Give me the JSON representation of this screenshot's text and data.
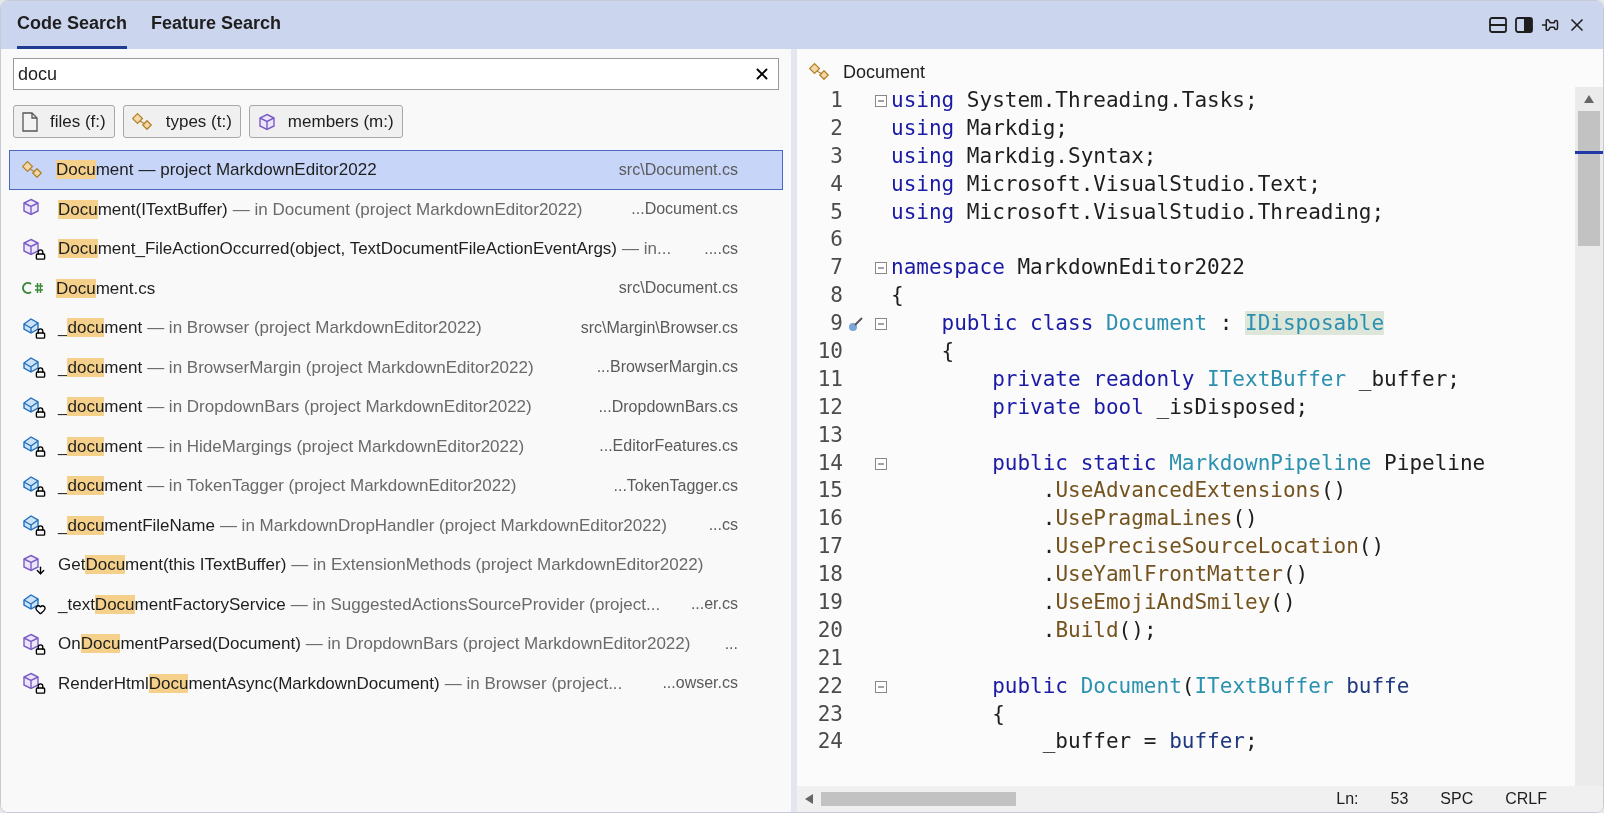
{
  "tabs": [
    {
      "label": "Code Search",
      "selected": true
    },
    {
      "label": "Feature Search",
      "selected": false
    }
  ],
  "search": {
    "value": "docu"
  },
  "filters": [
    {
      "kind": "file",
      "label": "files (f:)"
    },
    {
      "kind": "type",
      "label": "types (t:)"
    },
    {
      "kind": "member",
      "label": "members (m:)"
    }
  ],
  "results": [
    {
      "kind": "class",
      "match": "Docu",
      "after": "ment",
      "detail": "— project MarkdownEditor2022",
      "path": "src\\Document.cs",
      "selected": true
    },
    {
      "kind": "method",
      "match": "Docu",
      "after": "ment(ITextBuffer)",
      "detail": "— in Document (project MarkdownEditor2022)",
      "path": "...Document.cs",
      "selected": false
    },
    {
      "kind": "private_method",
      "match": "Docu",
      "after": "ment_FileActionOccurred(object, TextDocumentFileActionEventArgs)",
      "detail": "— in...",
      "path": "....cs",
      "selected": false
    },
    {
      "kind": "file",
      "match": "Docu",
      "after": "ment.cs",
      "path": "src\\Document.cs",
      "selected": false
    },
    {
      "kind": "private_field",
      "before": "_",
      "match": "docu",
      "after": "ment",
      "detail": "— in Browser (project MarkdownEditor2022)",
      "path": "src\\Margin\\Browser.cs",
      "selected": false
    },
    {
      "kind": "private_field",
      "before": "_",
      "match": "docu",
      "after": "ment",
      "detail": "— in BrowserMargin (project MarkdownEditor2022)",
      "path": "...BrowserMargin.cs",
      "selected": false
    },
    {
      "kind": "private_field",
      "before": "_",
      "match": "docu",
      "after": "ment",
      "detail": "— in DropdownBars (project MarkdownEditor2022)",
      "path": "...DropdownBars.cs",
      "selected": false
    },
    {
      "kind": "private_field",
      "before": "_",
      "match": "docu",
      "after": "ment",
      "detail": "— in HideMargings (project MarkdownEditor2022)",
      "path": "...EditorFeatures.cs",
      "selected": false
    },
    {
      "kind": "private_field",
      "before": "_",
      "match": "docu",
      "after": "ment",
      "detail": "— in TokenTagger (project MarkdownEditor2022)",
      "path": "...TokenTagger.cs",
      "selected": false
    },
    {
      "kind": "private_field",
      "before": "_",
      "match": "docu",
      "after": "mentFileName",
      "detail": "— in MarkdownDropHandler (project MarkdownEditor2022)",
      "path": "...cs",
      "selected": false
    },
    {
      "kind": "extension",
      "before": "Get",
      "match": "Docu",
      "after": "ment(this ITextBuffer)",
      "detail": "— in ExtensionMethods (project MarkdownEditor2022)",
      "selected": false
    },
    {
      "kind": "internal_field",
      "before": "_text",
      "match": "Docu",
      "after": "mentFactoryService",
      "detail": "— in SuggestedActionsSourceProvider (project...",
      "path": "...er.cs",
      "selected": false
    },
    {
      "kind": "private_method",
      "before": "On",
      "match": "Docu",
      "after": "mentParsed(Document)",
      "detail": "— in DropdownBars (project MarkdownEditor2022)",
      "path": "...",
      "selected": false
    },
    {
      "kind": "private_method",
      "before": "RenderHtml",
      "match": "Docu",
      "after": "mentAsync(MarkdownDocument)",
      "detail": "— in Browser (project...",
      "path": "...owser.cs",
      "selected": false
    }
  ],
  "editor": {
    "title": "Document",
    "lines": [
      {
        "number": "1",
        "fold": true,
        "tokens": [
          {
            "text": "using",
            "kind": "keyword"
          },
          {
            "text": " System.Threading.Tasks;",
            "kind": "plain"
          }
        ]
      },
      {
        "number": "2",
        "fold": false,
        "tokens": [
          {
            "text": "using",
            "kind": "keyword"
          },
          {
            "text": " Markdig;",
            "kind": "plain"
          }
        ]
      },
      {
        "number": "3",
        "fold": false,
        "tokens": [
          {
            "text": "using",
            "kind": "keyword"
          },
          {
            "text": " Markdig.Syntax;",
            "kind": "plain"
          }
        ]
      },
      {
        "number": "4",
        "fold": false,
        "tokens": [
          {
            "text": "using",
            "kind": "keyword"
          },
          {
            "text": " Microsoft.VisualStudio.Text;",
            "kind": "plain"
          }
        ]
      },
      {
        "number": "5",
        "fold": false,
        "tokens": [
          {
            "text": "using",
            "kind": "keyword"
          },
          {
            "text": " Microsoft.VisualStudio.Threading;",
            "kind": "plain"
          }
        ]
      },
      {
        "number": "6",
        "fold": false
      },
      {
        "number": "7",
        "fold": true,
        "tokens": [
          {
            "text": "namespace",
            "kind": "keyword"
          },
          {
            "text": " MarkdownEditor2022",
            "kind": "plain"
          }
        ]
      },
      {
        "number": "8",
        "fold": false,
        "tokens": [
          {
            "text": "{",
            "kind": "plain"
          }
        ]
      },
      {
        "number": "9",
        "fold": true,
        "pinned": true,
        "tokens": [
          {
            "text": "    public class",
            "kind": "keyword"
          },
          {
            "text": " Document",
            "kind": "type"
          },
          {
            "text": " : ",
            "kind": "plain"
          },
          {
            "text": "IDisposable",
            "kind": "type",
            "highlighted": true
          }
        ]
      },
      {
        "number": "10",
        "fold": false,
        "tokens": [
          {
            "text": "    {",
            "kind": "plain"
          }
        ]
      },
      {
        "number": "11",
        "fold": false,
        "tokens": [
          {
            "text": "        private readonly",
            "kind": "keyword"
          },
          {
            "text": " ITextBuffer",
            "kind": "type"
          },
          {
            "text": " _buffer;",
            "kind": "plain"
          }
        ]
      },
      {
        "number": "12",
        "fold": false,
        "tokens": [
          {
            "text": "        private bool",
            "kind": "keyword"
          },
          {
            "text": " _isDisposed;",
            "kind": "plain"
          }
        ]
      },
      {
        "number": "13",
        "fold": false
      },
      {
        "number": "14",
        "fold": true,
        "tokens": [
          {
            "text": "        public static",
            "kind": "keyword"
          },
          {
            "text": " MarkdownPipeline",
            "kind": "type"
          },
          {
            "text": " Pipeline",
            "kind": "plain"
          }
        ]
      },
      {
        "number": "15",
        "fold": false,
        "tokens": [
          {
            "text": "            .",
            "kind": "plain"
          },
          {
            "text": "UseAdvancedExtensions",
            "kind": "method"
          },
          {
            "text": "()",
            "kind": "plain"
          }
        ]
      },
      {
        "number": "16",
        "fold": false,
        "tokens": [
          {
            "text": "            .",
            "kind": "plain"
          },
          {
            "text": "UsePragmaLines",
            "kind": "method"
          },
          {
            "text": "()",
            "kind": "plain"
          }
        ]
      },
      {
        "number": "17",
        "fold": false,
        "tokens": [
          {
            "text": "            .",
            "kind": "plain"
          },
          {
            "text": "UsePreciseSourceLocation",
            "kind": "method"
          },
          {
            "text": "()",
            "kind": "plain"
          }
        ]
      },
      {
        "number": "18",
        "fold": false,
        "tokens": [
          {
            "text": "            .",
            "kind": "plain"
          },
          {
            "text": "UseYamlFrontMatter",
            "kind": "method"
          },
          {
            "text": "()",
            "kind": "plain"
          }
        ]
      },
      {
        "number": "19",
        "fold": false,
        "tokens": [
          {
            "text": "            .",
            "kind": "plain"
          },
          {
            "text": "UseEmojiAndSmiley",
            "kind": "method"
          },
          {
            "text": "()",
            "kind": "plain"
          }
        ]
      },
      {
        "number": "20",
        "fold": false,
        "tokens": [
          {
            "text": "            .",
            "kind": "plain"
          },
          {
            "text": "Build",
            "kind": "method"
          },
          {
            "text": "();",
            "kind": "plain"
          }
        ]
      },
      {
        "number": "21",
        "fold": false
      },
      {
        "number": "22",
        "fold": true,
        "tokens": [
          {
            "text": "        public",
            "kind": "keyword"
          },
          {
            "text": " Document",
            "kind": "type"
          },
          {
            "text": "(",
            "kind": "plain"
          },
          {
            "text": "ITextBuffer",
            "kind": "type"
          },
          {
            "text": " buffe",
            "kind": "param"
          }
        ]
      },
      {
        "number": "23",
        "fold": false,
        "tokens": [
          {
            "text": "        {",
            "kind": "plain"
          }
        ]
      },
      {
        "number": "24",
        "fold": false,
        "tokens": [
          {
            "text": "            _buffer = ",
            "kind": "plain"
          },
          {
            "text": "buffer",
            "kind": "param"
          },
          {
            "text": ";",
            "kind": "plain"
          }
        ]
      }
    ]
  },
  "status_bar": [
    "Ln:",
    "53",
    "SPC",
    "CRLF"
  ]
}
